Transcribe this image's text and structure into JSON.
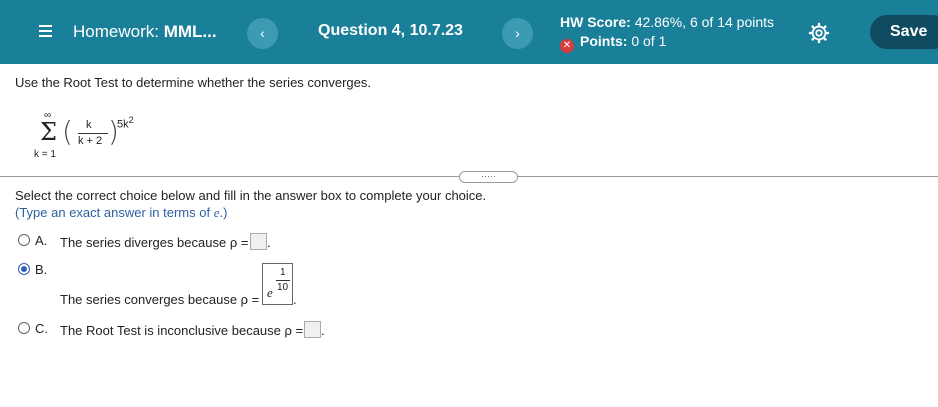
{
  "header": {
    "title_prefix": "Homework: ",
    "title_bold": "MML...",
    "prev_label": "‹",
    "next_label": "›",
    "question_title": "Question 4, 10.7.23",
    "score_label": "HW Score:",
    "score_value": "42.86%, 6 of 14 points",
    "points_label": "Points:",
    "points_value": "0 of 1",
    "save_label": "Save"
  },
  "question": {
    "prompt": "Use the Root Test to determine whether the series converges.",
    "series": {
      "upper": "∞",
      "sigma": "Σ",
      "lower": "k = 1",
      "numerator": "k",
      "denominator": "k + 2",
      "exponent_base": "5k",
      "exponent_power": "2"
    },
    "expand_dots": "·····",
    "instruction": "Select the correct choice below and fill in the answer box to complete your choice.",
    "hint_prefix": "(Type an exact answer in terms of ",
    "hint_var": "e",
    "hint_suffix": ".)"
  },
  "options": {
    "a": {
      "letter": "A.",
      "text": "The series diverges because ρ =",
      "period": "."
    },
    "b": {
      "letter": "B.",
      "text": "The series converges because ρ =",
      "period": ".",
      "answer_e": "e",
      "answer_num": "1",
      "answer_den": "10"
    },
    "c": {
      "letter": "C.",
      "text": "The Root Test is inconclusive because ρ =",
      "period": "."
    }
  },
  "colors": {
    "header_bg": "#1a7f99",
    "save_bg": "#0e4a60",
    "selected_radio": "#2f5fba",
    "hint_text": "#2f5f9e"
  }
}
